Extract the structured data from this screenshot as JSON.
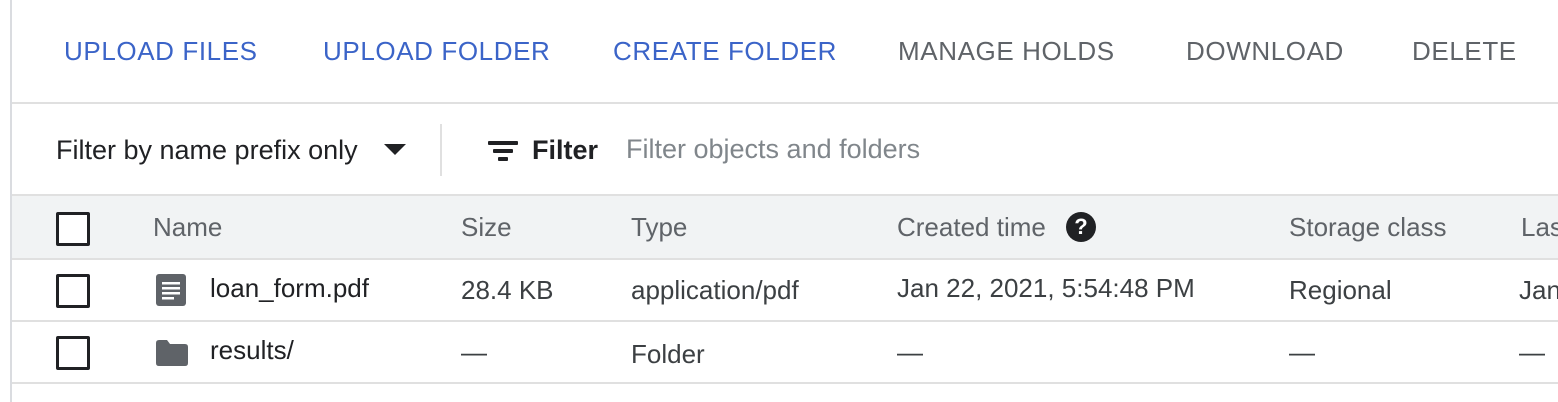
{
  "toolbar": {
    "upload_files": "UPLOAD FILES",
    "upload_folder": "UPLOAD FOLDER",
    "create_folder": "CREATE FOLDER",
    "manage_holds": "MANAGE HOLDS",
    "download": "DOWNLOAD",
    "delete": "DELETE"
  },
  "filterbar": {
    "prefix_option": "Filter by name prefix only",
    "filter_label": "Filter",
    "filter_placeholder": "Filter objects and folders",
    "filter_value": ""
  },
  "table": {
    "columns": {
      "name": "Name",
      "size": "Size",
      "type": "Type",
      "created": "Created time",
      "help": "?",
      "storage": "Storage class",
      "last": "Las"
    },
    "rows": [
      {
        "icon": "document-icon",
        "name": "loan_form.pdf",
        "size": "28.4 KB",
        "type": "application/pdf",
        "created": "Jan 22, 2021, 5:54:48 PM",
        "storage": "Regional",
        "last": "Jan"
      },
      {
        "icon": "folder-icon",
        "name": "results/",
        "size": "—",
        "type": "Folder",
        "created": "—",
        "storage": "—",
        "last": "—"
      }
    ]
  },
  "colors": {
    "accent": "#3b64c8",
    "disabled_text": "#5f6368",
    "header_bg": "#f1f3f4",
    "divider": "#e0e0e0"
  }
}
